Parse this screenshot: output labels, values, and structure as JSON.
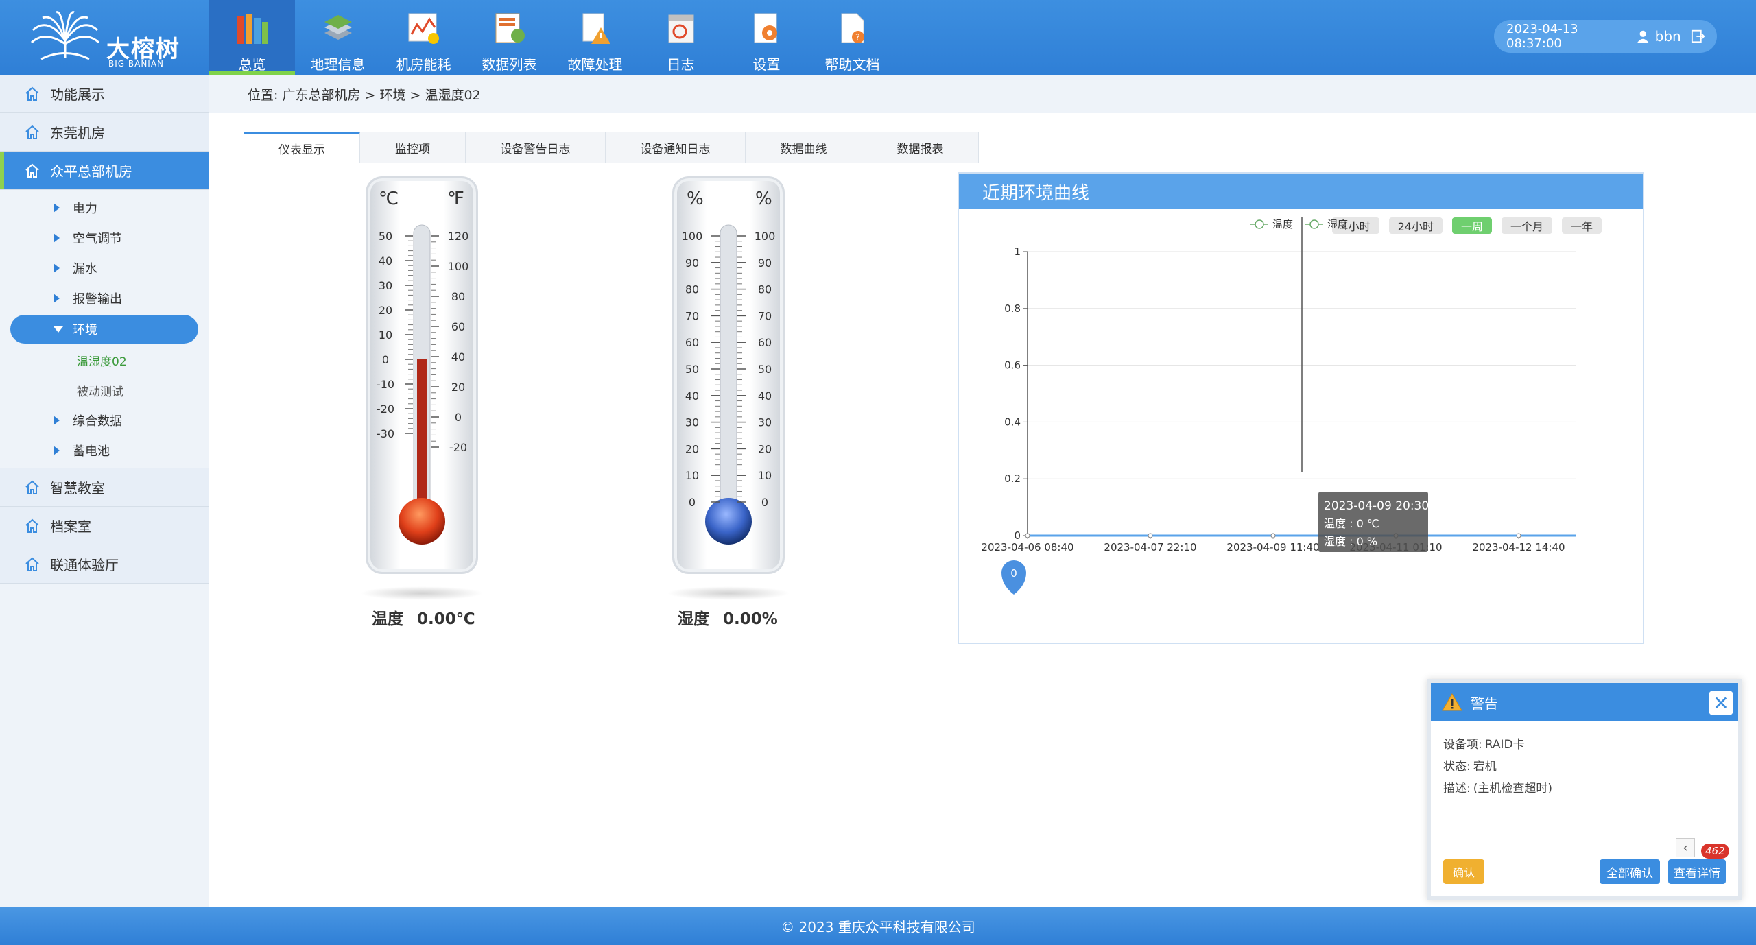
{
  "header": {
    "brand_cn": "大榕树",
    "brand_en": "BIG BANIAN",
    "nav": [
      {
        "label": "总览",
        "icon": "books-icon",
        "active": true
      },
      {
        "label": "地理信息",
        "icon": "map-layers-icon"
      },
      {
        "label": "机房能耗",
        "icon": "energy-chart-icon"
      },
      {
        "label": "数据列表",
        "icon": "data-list-icon"
      },
      {
        "label": "故障处理",
        "icon": "fault-warning-icon"
      },
      {
        "label": "日志",
        "icon": "log-calendar-icon"
      },
      {
        "label": "设置",
        "icon": "settings-gear-icon"
      },
      {
        "label": "帮助文档",
        "icon": "help-document-icon"
      }
    ],
    "datetime": "2023-04-13  08:37:00",
    "username": "bbn"
  },
  "sidebar": {
    "groups": [
      {
        "label": "功能展示"
      },
      {
        "label": "东莞机房"
      },
      {
        "label": "众平总部机房",
        "active": true
      }
    ],
    "sub_items": [
      {
        "label": "电力"
      },
      {
        "label": "空气调节"
      },
      {
        "label": "漏水"
      },
      {
        "label": "报警输出"
      },
      {
        "label": "环境",
        "open": true
      }
    ],
    "leaves": [
      {
        "label": "温湿度02",
        "current": true
      },
      {
        "label": "被动测试"
      }
    ],
    "sub_items_after": [
      {
        "label": "综合数据"
      },
      {
        "label": "蓄电池"
      }
    ],
    "groups_after": [
      {
        "label": "智慧教室"
      },
      {
        "label": "档案室"
      },
      {
        "label": "联通体验厅"
      }
    ]
  },
  "breadcrumb": "位置:  广东总部机房 > 环境 > 温湿度02",
  "tabs": [
    {
      "label": "仪表显示",
      "active": true
    },
    {
      "label": "监控项"
    },
    {
      "label": "设备警告日志"
    },
    {
      "label": "设备通知日志"
    },
    {
      "label": "数据曲线"
    },
    {
      "label": "数据报表"
    }
  ],
  "gauges": {
    "temp": {
      "unit_left": "℃",
      "unit_right": "℉",
      "ticks_left": [
        "50",
        "40",
        "30",
        "20",
        "10",
        "0",
        "-10",
        "-20",
        "-30"
      ],
      "ticks_right": [
        "120",
        "100",
        "80",
        "60",
        "40",
        "20",
        "0",
        "-20"
      ],
      "label": "温度",
      "value_text": "0.00℃",
      "value": 0,
      "min": -30,
      "max": 50
    },
    "humidity": {
      "unit_left": "%",
      "unit_right": "%",
      "ticks_left": [
        "100",
        "90",
        "80",
        "70",
        "60",
        "50",
        "40",
        "30",
        "20",
        "10",
        "0"
      ],
      "ticks_right": [
        "100",
        "90",
        "80",
        "70",
        "60",
        "50",
        "40",
        "30",
        "20",
        "10",
        "0"
      ],
      "label": "湿度",
      "value_text": "0.00%",
      "value": 0,
      "min": 0,
      "max": 100
    }
  },
  "chart_panel": {
    "title": "近期环境曲线",
    "ranges": [
      {
        "label": "4小时"
      },
      {
        "label": "24小时"
      },
      {
        "label": "一周",
        "active": true
      },
      {
        "label": "一个月"
      },
      {
        "label": "一年"
      }
    ],
    "tooltip": {
      "time": "2023-04-09 20:30",
      "temp": "温度 : 0 ℃",
      "humidity": "湿度 : 0 %"
    },
    "marker_label": "0"
  },
  "chart_data": {
    "type": "line",
    "legend": [
      "温度",
      "湿度"
    ],
    "legend_position": "top-center",
    "x_ticks": [
      "2023-04-06 08:40",
      "2023-04-07 22:10",
      "2023-04-09 11:40",
      "2023-04-11 01:10",
      "2023-04-12 14:40"
    ],
    "y_ticks": [
      "0",
      "0.2",
      "0.4",
      "0.6",
      "0.8",
      "1"
    ],
    "ylim": [
      0,
      1
    ],
    "grid": true,
    "series": [
      {
        "name": "温度",
        "values": [
          0,
          0,
          0,
          0,
          0
        ]
      },
      {
        "name": "湿度",
        "values": [
          0,
          0,
          0,
          0,
          0
        ]
      }
    ],
    "colors": {
      "line": "#5aa3ea",
      "axis": "#5aa3ea",
      "grid": "#e3e3e3"
    }
  },
  "alert": {
    "title": "警告",
    "device_key": "设备项:",
    "device_val": "RAID卡",
    "status_key": "状态:",
    "status_val": "宕机",
    "desc_key": "描述:",
    "desc_val": "(主机检查超时)",
    "confirm": "确认",
    "confirm_all": "全部确认",
    "detail": "查看详情",
    "count": "462",
    "close": "✕",
    "prev": "‹"
  },
  "footer": "© 2023   重庆众平科技有限公司",
  "colors": {
    "primary": "#3b8de0",
    "accent_green": "#8fd14f",
    "warn_orange": "#f0b030",
    "badge_red": "#d9342b"
  }
}
